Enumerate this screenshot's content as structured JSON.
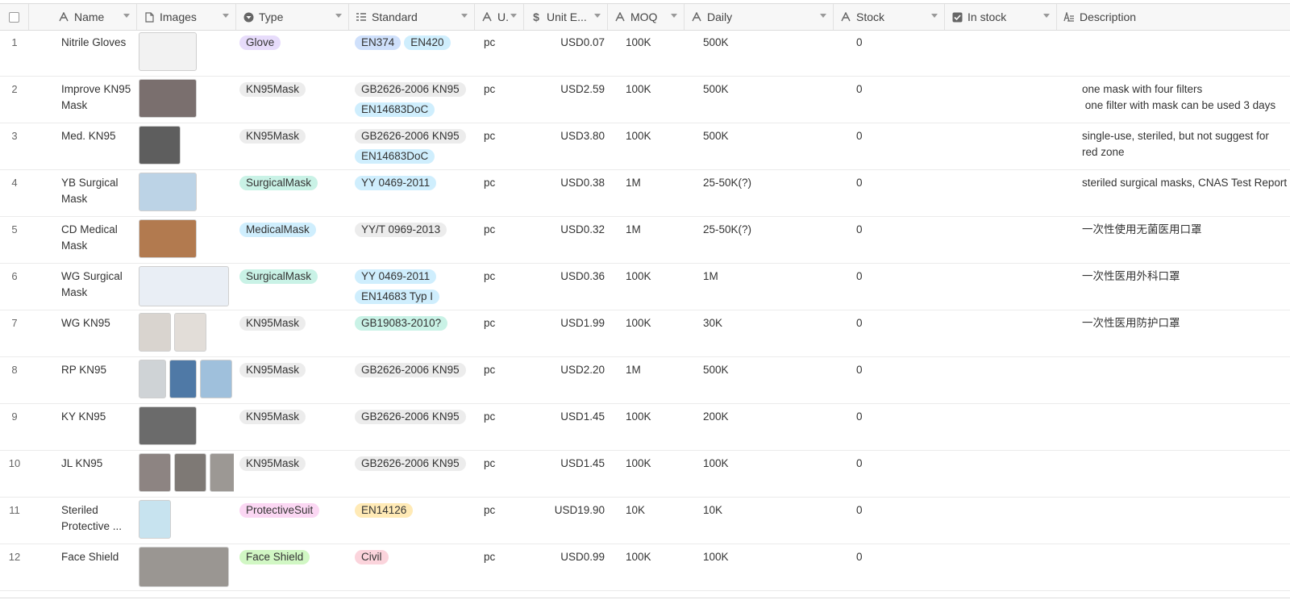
{
  "columns": [
    {
      "key": "name",
      "label": "Name",
      "icon": "text-icon"
    },
    {
      "key": "images",
      "label": "Images",
      "icon": "attachment-icon"
    },
    {
      "key": "type",
      "label": "Type",
      "icon": "single-select-icon"
    },
    {
      "key": "standard",
      "label": "Standard",
      "icon": "multi-select-icon"
    },
    {
      "key": "unit",
      "label": "U.",
      "icon": "text-icon"
    },
    {
      "key": "price",
      "label": "Unit E...",
      "icon": "currency-icon"
    },
    {
      "key": "moq",
      "label": "MOQ",
      "icon": "text-icon"
    },
    {
      "key": "daily",
      "label": "Daily",
      "icon": "text-icon"
    },
    {
      "key": "stock",
      "label": "Stock",
      "icon": "text-icon"
    },
    {
      "key": "instock",
      "label": "In stock",
      "icon": "checkbox-icon"
    },
    {
      "key": "description",
      "label": "Description",
      "icon": "long-text-icon"
    }
  ],
  "tag_colors": {
    "Glove": "#e7dcfb",
    "KN95Mask": "#ececec",
    "SurgicalMask": "#c9f2e6",
    "MedicalMask": "#cfeefd",
    "ProtectiveSuit": "#fbd7f3",
    "Face Shield": "#d1f7c4",
    "EN374": "#cfe0fb",
    "EN420": "#cfeefd",
    "GB2626-2006 KN95": "#ececec",
    "EN14683DoC": "#cfeefd",
    "YY 0469-2011": "#cfeefd",
    "YY/T 0969-2013": "#ececec",
    "EN14683 Typ I": "#cfeefd",
    "GB19083-2010?": "#c9f2e6",
    "EN14126": "#ffeab6",
    "Civil": "#fbd4dc"
  },
  "rows": [
    {
      "num": "1",
      "name": "Nitrile Gloves",
      "images": [
        {
          "size": "lg",
          "bg": "#f2f2f2"
        }
      ],
      "type": "Glove",
      "standard": [
        "EN374",
        "EN420"
      ],
      "unit": "pc",
      "price": "USD0.07",
      "moq": "100K",
      "daily": "500K",
      "stock": " 0",
      "description": ""
    },
    {
      "num": "2",
      "name": "Improve KN95 Mask",
      "images": [
        {
          "size": "lg",
          "bg": "#7a6f6e"
        }
      ],
      "type": "KN95Mask",
      "standard": [
        "GB2626-2006 KN95",
        "EN14683DoC"
      ],
      "unit": "pc",
      "price": "USD2.59",
      "moq": "100K",
      "daily": "500K",
      "stock": "0",
      "description": "one mask with four filters\n one filter with mask can be used 3 days"
    },
    {
      "num": "3",
      "name": "Med. KN95",
      "images": [
        {
          "size": "md",
          "bg": "#5e5e5e"
        }
      ],
      "type": "KN95Mask",
      "standard": [
        "GB2626-2006 KN95",
        "EN14683DoC"
      ],
      "unit": "pc",
      "price": "USD3.80",
      "moq": "100K",
      "daily": "500K",
      "stock": "0",
      "description": "single-use, steriled, but not suggest for\nred zone"
    },
    {
      "num": "4",
      "name": "YB Surgical Mask",
      "images": [
        {
          "size": "lg",
          "bg": "#bcd3e6"
        }
      ],
      "type": "SurgicalMask",
      "standard": [
        "YY 0469-2011"
      ],
      "unit": "pc",
      "price": "USD0.38",
      "moq": "1M",
      "daily": "25-50K(?)",
      "stock": "0",
      "description": "steriled surgical masks, CNAS Test Report"
    },
    {
      "num": "5",
      "name": "CD Medical Mask",
      "images": [
        {
          "size": "lg",
          "bg": "#b27a4f"
        }
      ],
      "type": "MedicalMask",
      "standard": [
        "YY/T 0969-2013"
      ],
      "unit": "pc",
      "price": "USD0.32",
      "moq": "1M",
      "daily": "25-50K(?)",
      "stock": "0",
      "description": "一次性使用无菌医用口罩"
    },
    {
      "num": "6",
      "name": "WG Surgical Mask",
      "images": [
        {
          "size": "xl",
          "bg": "#e9eef5"
        }
      ],
      "type": "SurgicalMask",
      "standard": [
        "YY 0469-2011",
        "EN14683 Typ I"
      ],
      "unit": "pc",
      "price": "USD0.36",
      "moq": "100K",
      "daily": "1M",
      "stock": "0",
      "description": "一次性医用外科口罩"
    },
    {
      "num": "7",
      "name": "WG KN95",
      "images": [
        {
          "size": "sm",
          "bg": "#d9d4cf"
        },
        {
          "size": "sm",
          "bg": "#e2ddd8"
        }
      ],
      "type": "KN95Mask",
      "standard": [
        "GB19083-2010?"
      ],
      "unit": "pc",
      "price": "USD1.99",
      "moq": "100K",
      "daily": "30K",
      "stock": "0",
      "description": "一次性医用防护口罩"
    },
    {
      "num": "8",
      "name": "RP KN95",
      "images": [
        {
          "size": "xs",
          "bg": "#cfd3d6"
        },
        {
          "size": "xs",
          "bg": "#4f79a6"
        },
        {
          "size": "sm",
          "bg": "#9fc0dc"
        }
      ],
      "type": "KN95Mask",
      "standard": [
        "GB2626-2006 KN95"
      ],
      "unit": "pc",
      "price": "USD2.20",
      "moq": "1M",
      "daily": "500K",
      "stock": "0",
      "description": ""
    },
    {
      "num": "9",
      "name": "KY KN95",
      "images": [
        {
          "size": "lg",
          "bg": "#6b6b6b"
        }
      ],
      "type": "KN95Mask",
      "standard": [
        "GB2626-2006 KN95"
      ],
      "unit": "pc",
      "price": "USD1.45",
      "moq": "100K",
      "daily": "200K",
      "stock": "0",
      "description": ""
    },
    {
      "num": "10",
      "name": "JL KN95",
      "images": [
        {
          "size": "sm",
          "bg": "#8d8482"
        },
        {
          "size": "sm",
          "bg": "#7e7975"
        },
        {
          "size": "xs",
          "bg": "#9c9894"
        }
      ],
      "type": "KN95Mask",
      "standard": [
        "GB2626-2006 KN95"
      ],
      "unit": "pc",
      "price": "USD1.45",
      "moq": "100K",
      "daily": "100K",
      "stock": "0",
      "description": ""
    },
    {
      "num": "11",
      "name": "Steriled Protective ...",
      "images": [
        {
          "size": "sm",
          "bg": "#c7e3ef"
        }
      ],
      "type": "ProtectiveSuit",
      "standard": [
        "EN14126"
      ],
      "unit": "pc",
      "price": "USD19.90",
      "moq": "10K",
      "daily": "10K",
      "stock": "0",
      "description": ""
    },
    {
      "num": "12",
      "name": "Face Shield",
      "images": [
        {
          "size": "xl",
          "bg": "#9a9692"
        }
      ],
      "type": "Face Shield",
      "standard": [
        "Civil"
      ],
      "unit": "pc",
      "price": "USD0.99",
      "moq": "100K",
      "daily": "100K",
      "stock": "0",
      "description": ""
    }
  ]
}
